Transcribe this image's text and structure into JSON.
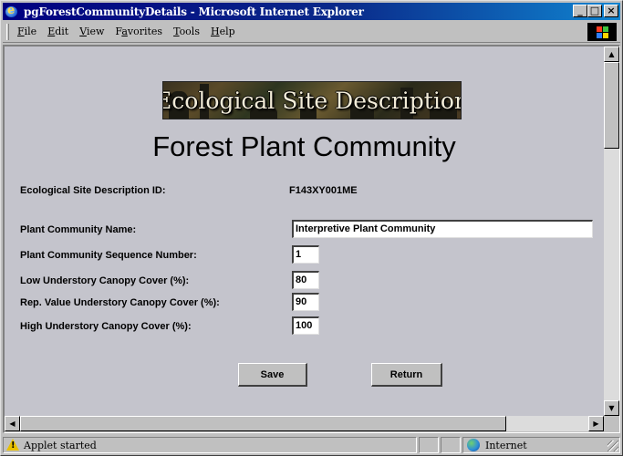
{
  "window": {
    "title": "pgForestCommunityDetails - Microsoft Internet Explorer",
    "controls": {
      "minimize": "_",
      "maximize": "□",
      "close": "×"
    }
  },
  "menu": {
    "items": [
      {
        "underline": "F",
        "rest": "ile"
      },
      {
        "underline": "E",
        "rest": "dit"
      },
      {
        "underline": "V",
        "rest": "iew"
      },
      {
        "pre": "F",
        "underline": "a",
        "rest": "vorites"
      },
      {
        "underline": "T",
        "rest": "ools"
      },
      {
        "underline": "H",
        "rest": "elp"
      }
    ]
  },
  "page": {
    "banner_text": "Ecological Site Description",
    "title": "Forest Plant Community",
    "fields": {
      "esd_id_label": "Ecological Site Description ID:",
      "esd_id_value": "F143XY001ME",
      "community_name_label": "Plant Community Name:",
      "community_name_value": "Interpretive Plant Community",
      "sequence_label": "Plant Community Sequence Number:",
      "sequence_value": "1",
      "low_cover_label": "Low Understory Canopy Cover (%):",
      "low_cover_value": "80",
      "rep_cover_label": "Rep. Value Understory Canopy Cover (%):",
      "rep_cover_value": "90",
      "high_cover_label": "High Understory Canopy Cover (%):",
      "high_cover_value": "100"
    },
    "buttons": {
      "save": "Save",
      "return": "Return"
    }
  },
  "statusbar": {
    "text": "Applet started",
    "zone": "Internet"
  },
  "icons": {
    "app": "ie-icon",
    "status": "warning-icon",
    "zone": "internet-globe-icon",
    "throbber": "windows-logo-icon"
  },
  "colors": {
    "titlebar_start": "#000080",
    "titlebar_end": "#1084d0",
    "page_background": "#c4c4cc",
    "chrome": "#c0c0c0"
  }
}
